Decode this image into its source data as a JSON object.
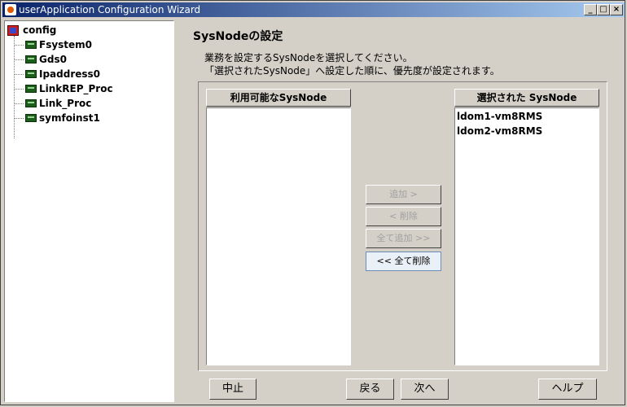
{
  "window": {
    "title": "userApplication Configuration Wizard"
  },
  "tree": {
    "root": "config",
    "children": [
      "Fsystem0",
      "Gds0",
      "Ipaddress0",
      "LinkREP_Proc",
      "Link_Proc",
      "symfoinst1"
    ]
  },
  "page": {
    "title": "SysNodeの設定",
    "description_line1": "業務を設定するSysNodeを選択してください。",
    "description_line2": "「選択されたSysNode」へ設定した順に、優先度が設定されます。"
  },
  "available": {
    "header": "利用可能なSysNode",
    "items": []
  },
  "selected": {
    "header": "選択された SysNode",
    "items": [
      "ldom1-vm8RMS",
      "ldom2-vm8RMS"
    ]
  },
  "transfer_buttons": {
    "add": "追加 >",
    "remove": "< 削除",
    "add_all": "全て追加 >>",
    "remove_all": "<< 全て削除"
  },
  "footer": {
    "cancel": "中止",
    "back": "戻る",
    "next": "次へ",
    "help": "ヘルプ"
  }
}
